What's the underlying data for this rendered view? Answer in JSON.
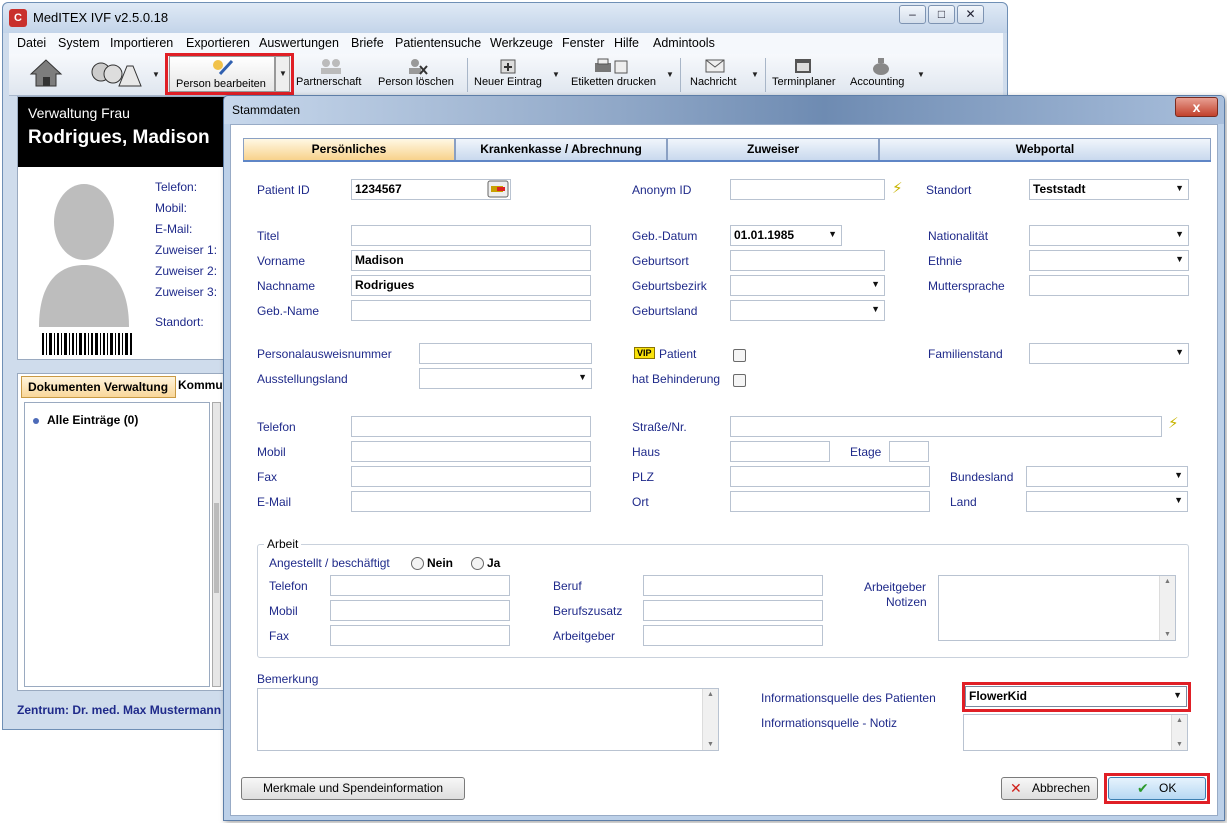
{
  "app": {
    "title": "MedITEX IVF v2.5.0.18",
    "icon_label": "C"
  },
  "menubar": [
    "Datei",
    "System",
    "Importieren",
    "Exportieren",
    "Auswertungen",
    "Briefe",
    "Patientensuche",
    "Werkzeuge",
    "Fenster",
    "Hilfe",
    "Admintools"
  ],
  "toolbar": {
    "person_bearbeiten": "Person bearbeiten",
    "partnerschaft": "Partnerschaft",
    "person_loeschen": "Person löschen",
    "neuer_eintrag": "Neuer Eintrag",
    "etiketten_drucken": "Etiketten drucken",
    "nachricht": "Nachricht",
    "terminplaner": "Terminplaner",
    "accounting": "Accounting"
  },
  "patient_panel": {
    "role": "Verwaltung Frau",
    "name": "Rodrigues, Madison",
    "fields": [
      "Telefon:",
      "Mobil:",
      "E-Mail:",
      "Zuweiser 1:",
      "Zuweiser 2:",
      "Zuweiser 3:",
      "Standort:"
    ]
  },
  "doc_panel": {
    "tab": "Dokumenten Verwaltung",
    "tab2": "Kommu",
    "entry": "Alle Einträge (0)"
  },
  "status_bar": "Zentrum: Dr. med. Max Mustermann",
  "dialog": {
    "title": "Stammdaten",
    "close": "x",
    "tabs": [
      "Persönliches",
      "Krankenkasse / Abrechnung",
      "Zuweiser",
      "Webportal"
    ],
    "labels": {
      "patient_id": "Patient ID",
      "anonym_id": "Anonym ID",
      "standort": "Standort",
      "titel": "Titel",
      "geb_datum": "Geb.-Datum",
      "nationalitaet": "Nationalität",
      "vorname": "Vorname",
      "geburtsort": "Geburtsort",
      "ethnie": "Ethnie",
      "nachname": "Nachname",
      "geburtsbezirk": "Geburtsbezirk",
      "muttersprache": "Muttersprache",
      "geb_name": "Geb.-Name",
      "geburtsland": "Geburtsland",
      "personalausweis": "Personalausweisnummer",
      "vip_patient": "Patient",
      "familienstand": "Familienstand",
      "ausstellungsland": "Ausstellungsland",
      "behinderung": "hat Behinderung",
      "telefon": "Telefon",
      "strasse": "Straße/Nr.",
      "mobil": "Mobil",
      "haus": "Haus",
      "etage": "Etage",
      "fax": "Fax",
      "plz": "PLZ",
      "bundesland": "Bundesland",
      "email": "E-Mail",
      "ort": "Ort",
      "land": "Land",
      "arbeit": "Arbeit",
      "angestellt": "Angestellt / beschäftigt",
      "nein": "Nein",
      "ja": "Ja",
      "a_telefon": "Telefon",
      "a_mobil": "Mobil",
      "a_fax": "Fax",
      "beruf": "Beruf",
      "berufszusatz": "Berufszusatz",
      "arbeitgeber": "Arbeitgeber",
      "arbeitgeber_notizen_1": "Arbeitgeber",
      "arbeitgeber_notizen_2": "Notizen",
      "bemerkung": "Bemerkung",
      "info_quelle": "Informationsquelle des Patienten",
      "info_notiz": "Informationsquelle - Notiz",
      "vip_badge": "VIP"
    },
    "values": {
      "patient_id": "1234567",
      "standort": "Teststadt",
      "geb_datum": "01.01.1985",
      "vorname": "Madison",
      "nachname": "Rodrigues",
      "info_quelle": "FlowerKid"
    },
    "buttons": {
      "merkmale": "Merkmale und Spendeinformation",
      "abbrechen": "Abbrechen",
      "ok": "OK"
    }
  }
}
